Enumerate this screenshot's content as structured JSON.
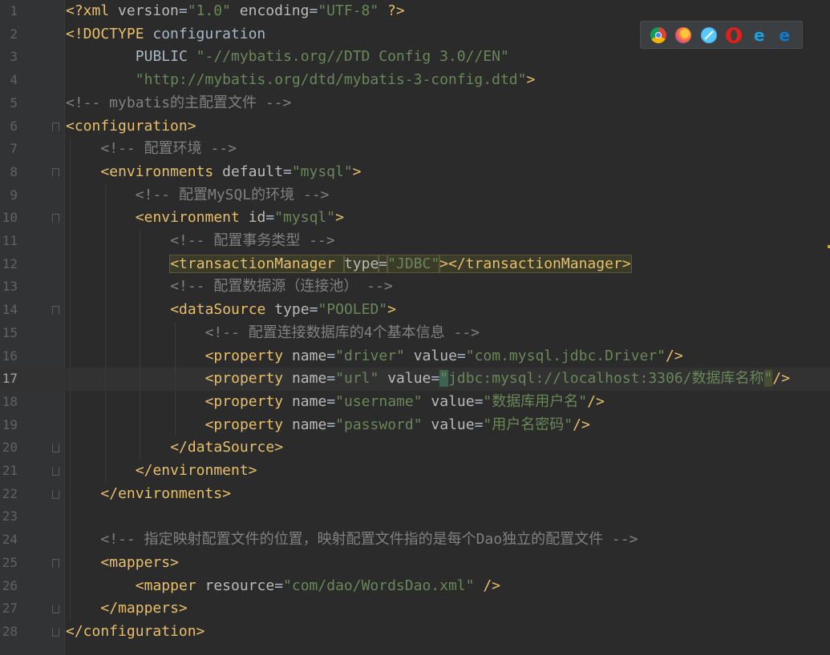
{
  "editor": {
    "language": "xml",
    "current_line": 17,
    "lines": [
      {
        "n": "1",
        "indent": 0,
        "parts": [
          [
            "decl",
            "<?xml "
          ],
          [
            "attr",
            "version"
          ],
          [
            "txt",
            "="
          ],
          [
            "str",
            "\"1.0\""
          ],
          [
            "txt",
            " "
          ],
          [
            "attr",
            "encoding"
          ],
          [
            "txt",
            "="
          ],
          [
            "str",
            "\"UTF-8\""
          ],
          [
            "txt",
            " "
          ],
          [
            "decl",
            "?>"
          ]
        ]
      },
      {
        "n": "2",
        "indent": 0,
        "parts": [
          [
            "decl",
            "<!DOCTYPE "
          ],
          [
            "txt",
            "configuration"
          ]
        ]
      },
      {
        "n": "3",
        "indent": 8,
        "parts": [
          [
            "txt",
            "PUBLIC "
          ],
          [
            "str",
            "\"-//mybatis.org//DTD Config 3.0//EN\""
          ]
        ]
      },
      {
        "n": "4",
        "indent": 8,
        "parts": [
          [
            "str",
            "\"http://mybatis.org/dtd/mybatis-3-config.dtd\""
          ],
          [
            "decl",
            ">"
          ]
        ]
      },
      {
        "n": "5",
        "indent": 0,
        "parts": [
          [
            "cm",
            "<!-- mybatis的主配置文件 -->"
          ]
        ]
      },
      {
        "n": "6",
        "indent": 0,
        "fold": "open",
        "parts": [
          [
            "tag",
            "<configuration>"
          ]
        ]
      },
      {
        "n": "7",
        "indent": 4,
        "parts": [
          [
            "cm",
            "<!-- 配置环境 -->"
          ]
        ]
      },
      {
        "n": "8",
        "indent": 4,
        "fold": "open",
        "parts": [
          [
            "tag",
            "<environments "
          ],
          [
            "attr",
            "default"
          ],
          [
            "txt",
            "="
          ],
          [
            "str",
            "\"mysql\""
          ],
          [
            "tag",
            ">"
          ]
        ]
      },
      {
        "n": "9",
        "indent": 8,
        "parts": [
          [
            "cm",
            "<!-- 配置MySQL的环境 -->"
          ]
        ]
      },
      {
        "n": "10",
        "indent": 8,
        "fold": "open",
        "parts": [
          [
            "tag",
            "<environment "
          ],
          [
            "attr",
            "id"
          ],
          [
            "txt",
            "="
          ],
          [
            "str",
            "\"mysql\""
          ],
          [
            "tag",
            ">"
          ]
        ]
      },
      {
        "n": "11",
        "indent": 12,
        "parts": [
          [
            "cm",
            "<!-- 配置事务类型 -->"
          ]
        ]
      },
      {
        "n": "12",
        "indent": 12,
        "parts": [
          [
            "hl-tag",
            "<transactionManager "
          ],
          [
            "hl-attr",
            "type"
          ],
          [
            "hl-txt",
            "="
          ],
          [
            "hl-str",
            "\"JDBC\""
          ],
          [
            "hl-tag",
            "></transactionManager>"
          ]
        ]
      },
      {
        "n": "13",
        "indent": 12,
        "parts": [
          [
            "cm",
            "<!-- 配置数据源（连接池） -->"
          ]
        ]
      },
      {
        "n": "14",
        "indent": 12,
        "fold": "open",
        "parts": [
          [
            "tag",
            "<dataSource "
          ],
          [
            "attr",
            "type"
          ],
          [
            "txt",
            "="
          ],
          [
            "str",
            "\"POOLED\""
          ],
          [
            "tag",
            ">"
          ]
        ]
      },
      {
        "n": "15",
        "indent": 16,
        "parts": [
          [
            "cm",
            "<!-- 配置连接数据库的4个基本信息 -->"
          ]
        ]
      },
      {
        "n": "16",
        "indent": 16,
        "parts": [
          [
            "tag",
            "<property "
          ],
          [
            "attr",
            "name"
          ],
          [
            "txt",
            "="
          ],
          [
            "str",
            "\"driver\""
          ],
          [
            "txt",
            " "
          ],
          [
            "attr",
            "value"
          ],
          [
            "txt",
            "="
          ],
          [
            "str",
            "\"com.mysql.jdbc.Driver\""
          ],
          [
            "tag",
            "/>"
          ]
        ]
      },
      {
        "n": "17",
        "indent": 16,
        "parts": [
          [
            "tag",
            "<property "
          ],
          [
            "attr",
            "name"
          ],
          [
            "txt",
            "="
          ],
          [
            "str",
            "\"url\""
          ],
          [
            "txt",
            " "
          ],
          [
            "attr",
            "value"
          ],
          [
            "txt",
            "="
          ],
          [
            "caret-q",
            "\""
          ],
          [
            "str",
            "jdbc:mysql://localhost:3306/数据库名称"
          ],
          [
            "caret-end",
            "\""
          ],
          [
            "tag",
            "/>"
          ]
        ]
      },
      {
        "n": "18",
        "indent": 16,
        "parts": [
          [
            "tag",
            "<property "
          ],
          [
            "attr",
            "name"
          ],
          [
            "txt",
            "="
          ],
          [
            "str",
            "\"username\""
          ],
          [
            "txt",
            " "
          ],
          [
            "attr",
            "value"
          ],
          [
            "txt",
            "="
          ],
          [
            "str",
            "\"数据库用户名\""
          ],
          [
            "tag",
            "/>"
          ]
        ]
      },
      {
        "n": "19",
        "indent": 16,
        "parts": [
          [
            "tag",
            "<property "
          ],
          [
            "attr",
            "name"
          ],
          [
            "txt",
            "="
          ],
          [
            "str",
            "\"password\""
          ],
          [
            "txt",
            " "
          ],
          [
            "attr",
            "value"
          ],
          [
            "txt",
            "="
          ],
          [
            "str",
            "\"用户名密码\""
          ],
          [
            "tag",
            "/>"
          ]
        ]
      },
      {
        "n": "20",
        "indent": 12,
        "fold": "close",
        "parts": [
          [
            "tag",
            "</dataSource>"
          ]
        ]
      },
      {
        "n": "21",
        "indent": 8,
        "fold": "close",
        "parts": [
          [
            "tag",
            "</environment>"
          ]
        ]
      },
      {
        "n": "22",
        "indent": 4,
        "fold": "close",
        "parts": [
          [
            "tag",
            "</environments>"
          ]
        ]
      },
      {
        "n": "23",
        "indent": 0,
        "parts": []
      },
      {
        "n": "24",
        "indent": 4,
        "parts": [
          [
            "cm",
            "<!-- 指定映射配置文件的位置，映射配置文件指的是每个Dao独立的配置文件 -->"
          ]
        ]
      },
      {
        "n": "25",
        "indent": 4,
        "fold": "open",
        "parts": [
          [
            "tag",
            "<mappers>"
          ]
        ]
      },
      {
        "n": "26",
        "indent": 8,
        "parts": [
          [
            "tag",
            "<mapper "
          ],
          [
            "attr",
            "resource"
          ],
          [
            "txt",
            "="
          ],
          [
            "str",
            "\"com/dao/WordsDao.xml\""
          ],
          [
            "txt",
            " "
          ],
          [
            "tag",
            "/>"
          ]
        ]
      },
      {
        "n": "27",
        "indent": 4,
        "fold": "close",
        "parts": [
          [
            "tag",
            "</mappers>"
          ]
        ]
      },
      {
        "n": "28",
        "indent": 0,
        "fold": "close",
        "parts": [
          [
            "tag",
            "</configuration>"
          ]
        ]
      }
    ]
  },
  "browser_bar": {
    "icons": [
      "chrome-icon",
      "firefox-icon",
      "safari-icon",
      "opera-icon",
      "ie-icon",
      "edge-icon"
    ],
    "ie_glyph": "e",
    "edge_glyph": "e"
  },
  "colors": {
    "background": "#2b2b2b",
    "tag": "#e8bf6a",
    "attribute": "#bababa",
    "string": "#6a8759",
    "comment": "#808080",
    "line_number": "#606366"
  }
}
